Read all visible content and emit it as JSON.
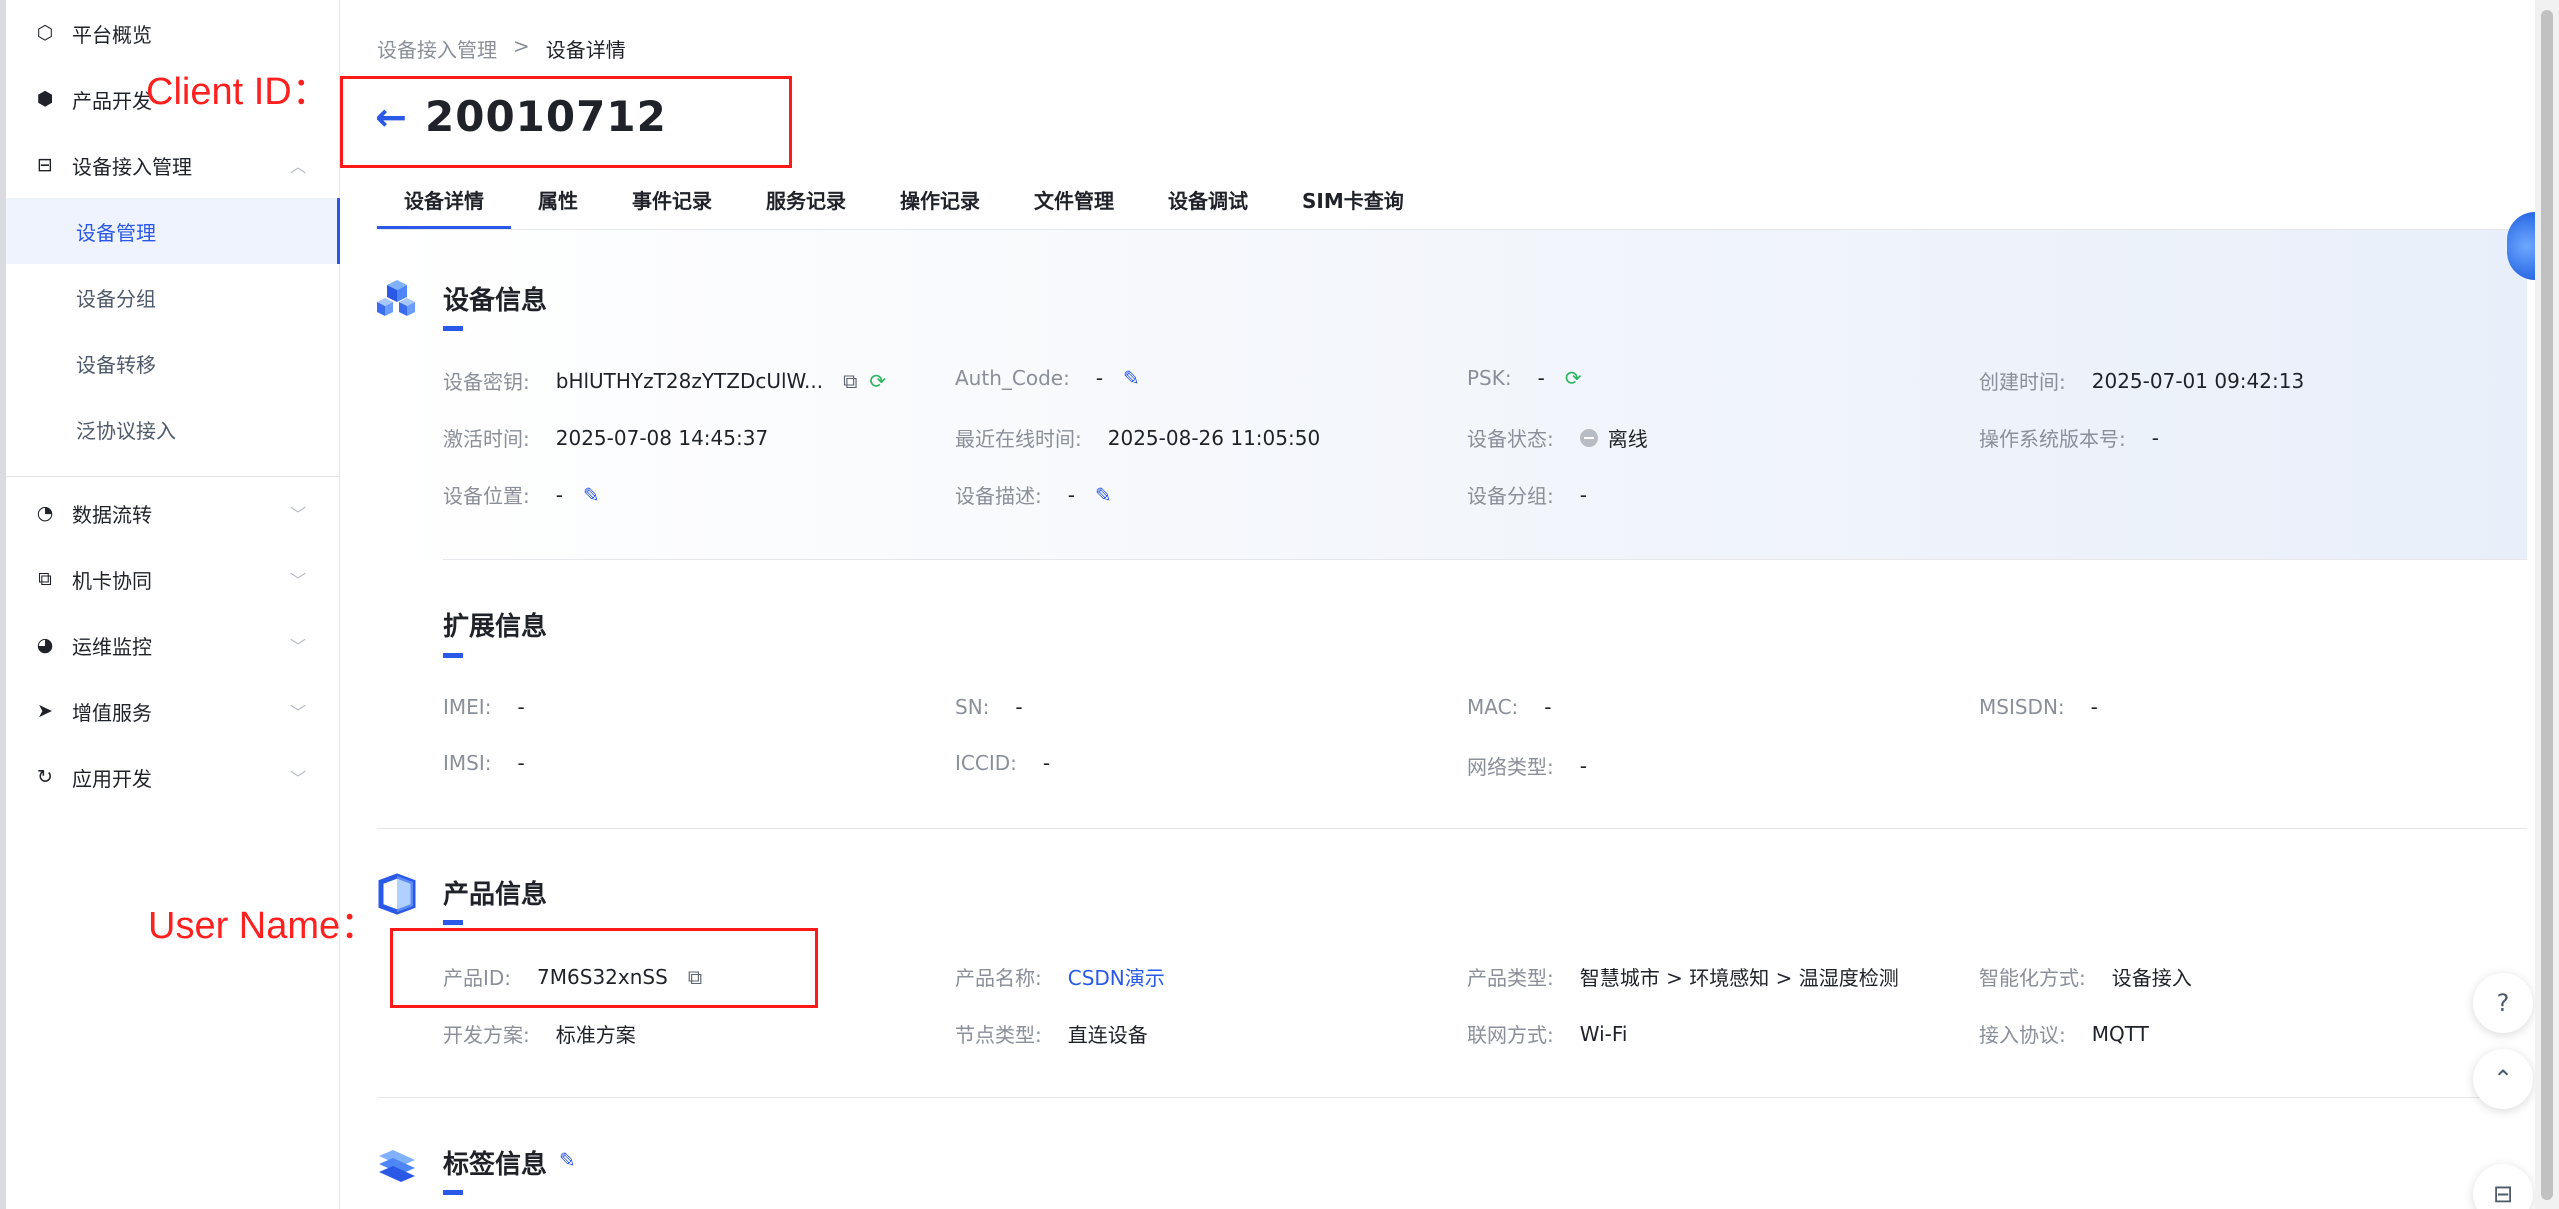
{
  "sidebar": {
    "items": [
      {
        "label": "平台概览",
        "icon": "overview-icon"
      },
      {
        "label": "产品开发",
        "icon": "cube-icon"
      },
      {
        "label": "设备接入管理",
        "icon": "device-access-icon"
      },
      {
        "label": "数据流转",
        "icon": "data-flow-icon"
      },
      {
        "label": "机卡协同",
        "icon": "card-sync-icon"
      },
      {
        "label": "运维监控",
        "icon": "monitor-icon"
      },
      {
        "label": "增值服务",
        "icon": "send-icon"
      },
      {
        "label": "应用开发",
        "icon": "app-dev-icon"
      }
    ],
    "sub_items": [
      {
        "label": "设备管理"
      },
      {
        "label": "设备分组"
      },
      {
        "label": "设备转移"
      },
      {
        "label": "泛协议接入"
      }
    ]
  },
  "breadcrumb": {
    "parent": "设备接入管理",
    "separator": ">",
    "current": "设备详情"
  },
  "page": {
    "title": "20010712"
  },
  "tabs": [
    "设备详情",
    "属性",
    "事件记录",
    "服务记录",
    "操作记录",
    "文件管理",
    "设备调试",
    "SIM卡查询"
  ],
  "device_info": {
    "title": "设备信息",
    "fields": [
      {
        "k": "设备密钥:",
        "v": "bHlUTHYzT28zYTZDcUlW..."
      },
      {
        "k": "Auth_Code:",
        "v": "-"
      },
      {
        "k": "PSK:",
        "v": "-"
      },
      {
        "k": "创建时间:",
        "v": "2025-07-01 09:42:13"
      },
      {
        "k": "激活时间:",
        "v": "2025-07-08 14:45:37"
      },
      {
        "k": "最近在线时间:",
        "v": "2025-08-26 11:05:50"
      },
      {
        "k": "设备状态:",
        "v": "离线"
      },
      {
        "k": "操作系统版本号:",
        "v": "-"
      },
      {
        "k": "设备位置:",
        "v": "-"
      },
      {
        "k": "设备描述:",
        "v": "-"
      },
      {
        "k": "设备分组:",
        "v": "-"
      }
    ]
  },
  "ext_info": {
    "title": "扩展信息",
    "fields": [
      {
        "k": "IMEI:",
        "v": "-"
      },
      {
        "k": "SN:",
        "v": "-"
      },
      {
        "k": "MAC:",
        "v": "-"
      },
      {
        "k": "MSISDN:",
        "v": "-"
      },
      {
        "k": "IMSI:",
        "v": "-"
      },
      {
        "k": "ICCID:",
        "v": "-"
      },
      {
        "k": "网络类型:",
        "v": "-"
      }
    ]
  },
  "product_info": {
    "title": "产品信息",
    "fields": [
      {
        "k": "产品ID:",
        "v": "7M6S32xnSS"
      },
      {
        "k": "产品名称:",
        "v": "CSDN演示"
      },
      {
        "k": "产品类型:",
        "v": "智慧城市 > 环境感知 > 温湿度检测"
      },
      {
        "k": "智能化方式:",
        "v": "设备接入"
      },
      {
        "k": "开发方案:",
        "v": "标准方案"
      },
      {
        "k": "节点类型:",
        "v": "直连设备"
      },
      {
        "k": "联网方式:",
        "v": "Wi-Fi"
      },
      {
        "k": "接入协议:",
        "v": "MQTT"
      }
    ]
  },
  "tag_info": {
    "title": "标签信息"
  },
  "annotations": {
    "client_id": "Client ID：",
    "user_name": "User Name："
  },
  "colors": {
    "accent": "#2a59e8",
    "annotation": "#ff1a1a",
    "success": "#2bb55e"
  }
}
